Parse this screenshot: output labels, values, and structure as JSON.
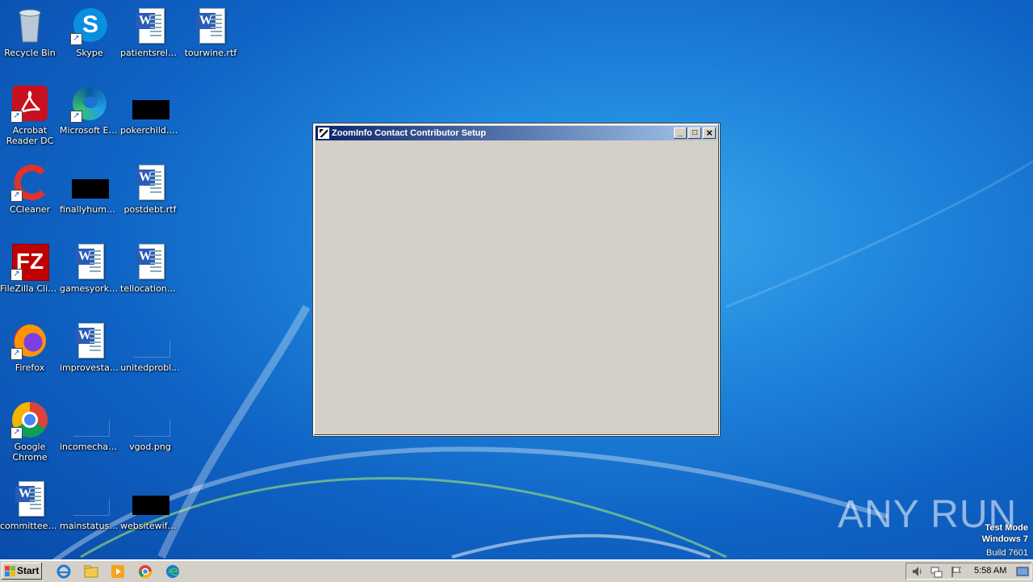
{
  "desktop": {
    "icons": [
      {
        "label": "Recycle Bin"
      },
      {
        "label": "Skype"
      },
      {
        "label": "patientsrela..."
      },
      {
        "label": "tourwine.rtf"
      },
      {
        "label": "Acrobat Reader DC"
      },
      {
        "label": "Microsoft Edge"
      },
      {
        "label": "pokerchild.jpg"
      },
      {
        "label": "CCleaner"
      },
      {
        "label": "finallyhuma..."
      },
      {
        "label": "postdebt.rtf"
      },
      {
        "label": "FileZilla Client"
      },
      {
        "label": "gamesyork.rtf"
      },
      {
        "label": "tellocations.rtf"
      },
      {
        "label": "Firefox"
      },
      {
        "label": "improvestat..."
      },
      {
        "label": "unitedprobl..."
      },
      {
        "label": "Google Chrome"
      },
      {
        "label": "incomechat...."
      },
      {
        "label": "vgod.png"
      },
      {
        "label": "committeeo..."
      },
      {
        "label": "mainstatus...."
      },
      {
        "label": "websitewife..."
      }
    ]
  },
  "window": {
    "title": "ZoomInfo Contact Contributor Setup",
    "minimize": "_",
    "maximize": "□",
    "close": "×"
  },
  "taskbar": {
    "start_label": "Start",
    "clock": "5:58 AM"
  },
  "watermark": {
    "brand": "ANY RUN",
    "line1": "Test Mode",
    "line2": "Windows 7",
    "line3": "Build 7601"
  },
  "colors": {
    "desktop_blue": "#1f86dc",
    "titlebar_start": "#0a246a",
    "titlebar_end": "#a6caf0",
    "window_face": "#d4d0c8"
  }
}
